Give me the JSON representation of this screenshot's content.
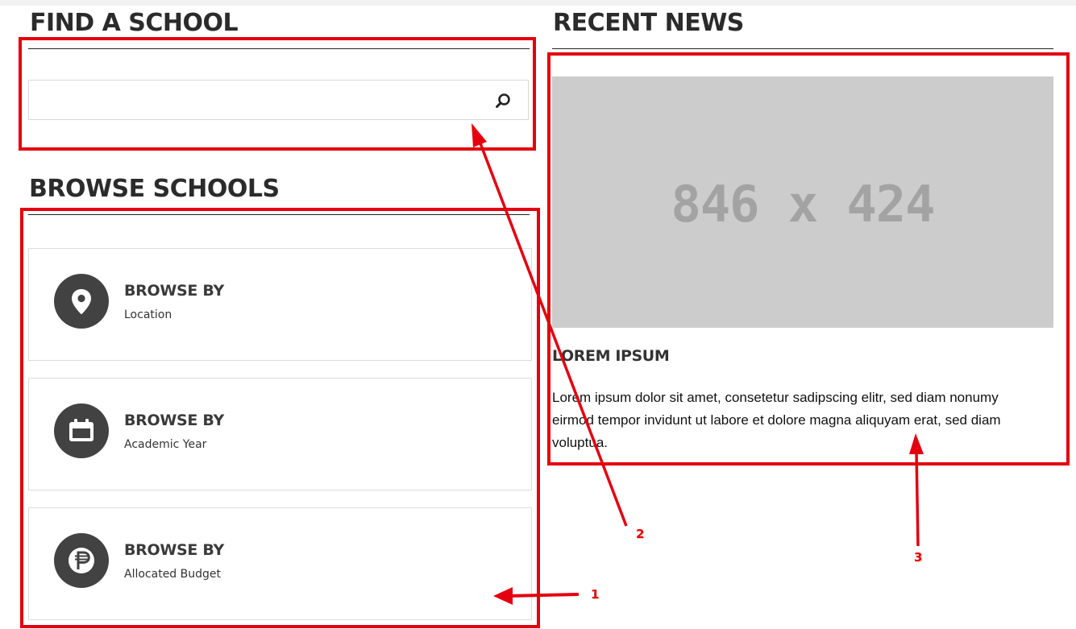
{
  "find_school": {
    "heading": "FIND A SCHOOL",
    "search": {
      "value": "",
      "placeholder": "",
      "icon": "search-icon"
    }
  },
  "browse_schools": {
    "heading": "BROWSE SCHOOLS",
    "cards": [
      {
        "title": "BROWSE BY",
        "subtitle": "Location",
        "icon": "map-pin-icon"
      },
      {
        "title": "BROWSE BY",
        "subtitle": "Academic Year",
        "icon": "calendar-icon"
      },
      {
        "title": "BROWSE BY",
        "subtitle": "Allocated Budget",
        "icon": "peso-icon"
      }
    ]
  },
  "recent_news": {
    "heading": "RECENT NEWS",
    "image_placeholder": "846 x 424",
    "article_title": "LOREM IPSUM",
    "article_body": "Lorem ipsum dolor sit amet, consetetur sadipscing elitr, sed diam nonumy eirmod tempor invidunt ut labore et dolore magna aliquyam erat, sed diam voluptua."
  },
  "annotations": {
    "labels": [
      "1",
      "2",
      "3"
    ],
    "color": "#e3000f"
  },
  "colors": {
    "icon_circle": "#424242",
    "placeholder_bg": "#cccccc",
    "placeholder_text": "#a3a3a3"
  }
}
